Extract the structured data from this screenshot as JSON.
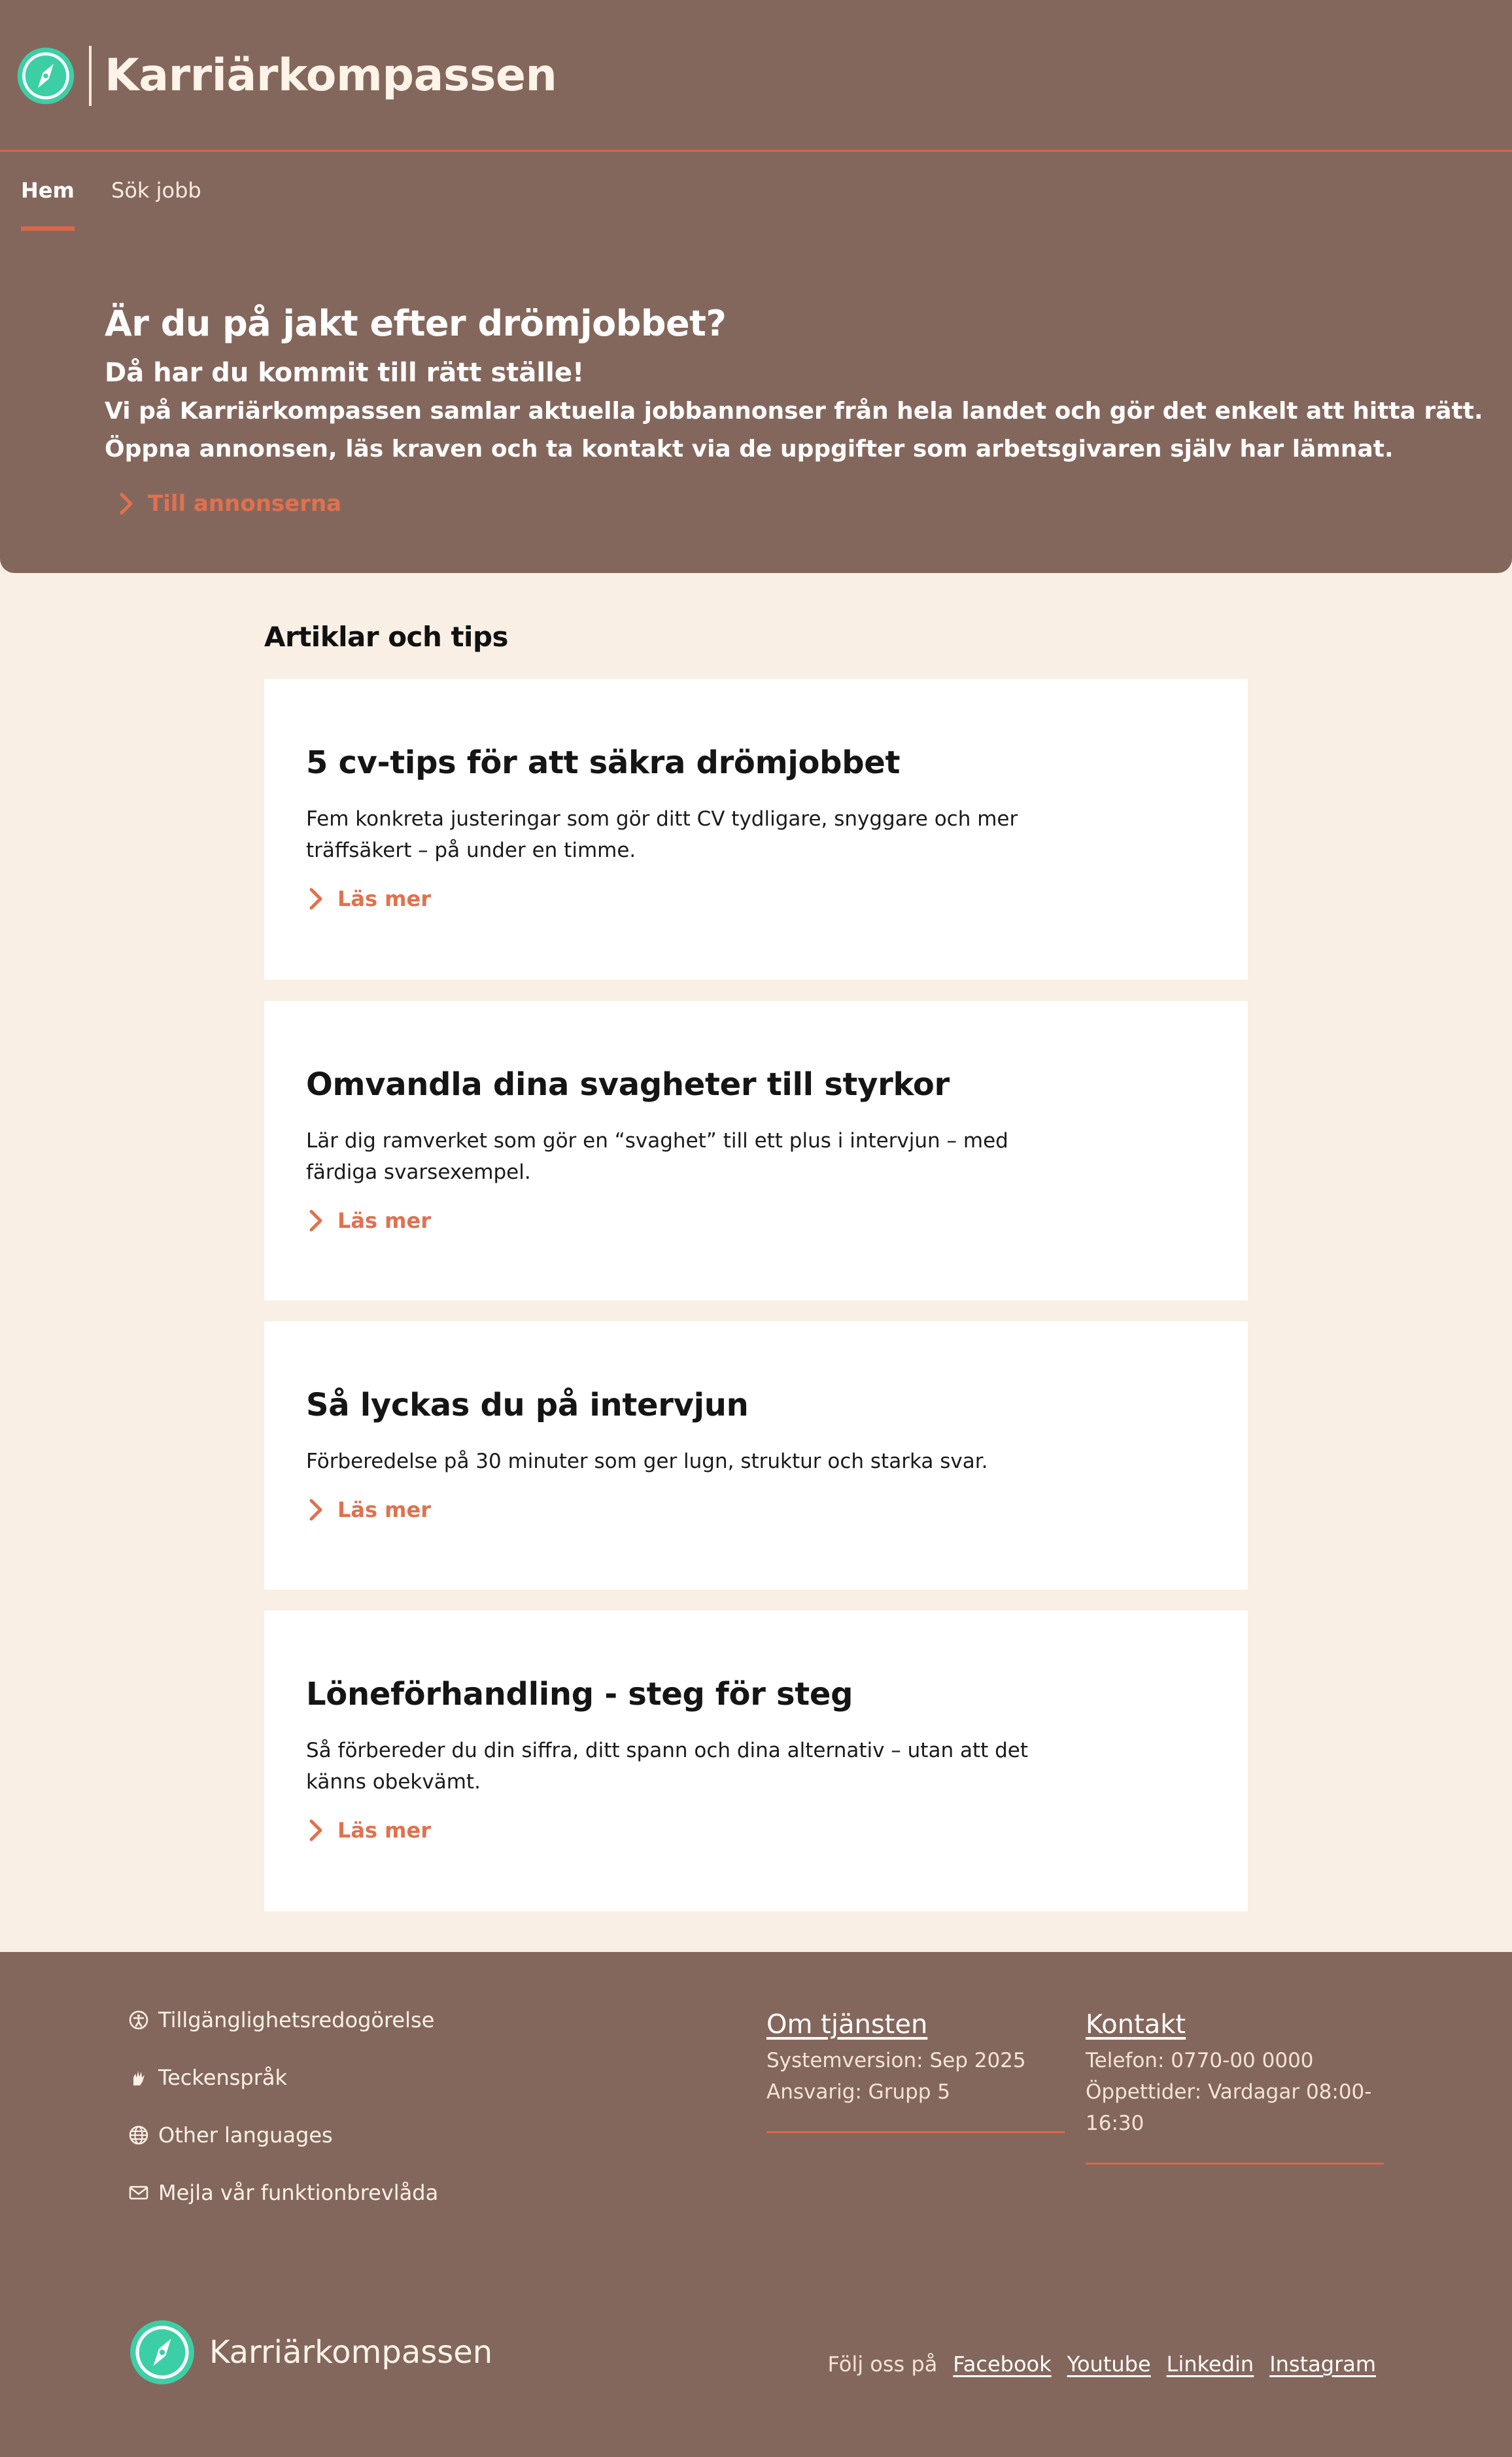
{
  "header": {
    "brand_name": "Karriärkompassen",
    "logo_icon": "compass-icon",
    "nav": [
      {
        "label": "Hem",
        "active": true
      },
      {
        "label": "Sök jobb",
        "active": false
      }
    ]
  },
  "hero": {
    "title": "Är du på jakt efter drömjobbet?",
    "subtitle": "Då har du kommit till rätt ställe!",
    "text_line1": "Vi på Karriärkompassen samlar aktuella jobbannonser från hela landet och gör det enkelt att hitta rätt.",
    "text_line2": "Öppna annonsen, läs kraven och ta kontakt via de uppgifter som arbetsgivaren själv har lämnat.",
    "link_label": "Till annonserna"
  },
  "articles": {
    "heading": "Artiklar och tips",
    "link_label": "Läs mer",
    "items": [
      {
        "title": "5 cv-tips för att säkra drömjobbet",
        "description": "Fem konkreta justeringar som gör ditt CV tydligare, snyggare och mer träffsäkert – på under en timme."
      },
      {
        "title": "Omvandla dina svagheter till styrkor",
        "description": "Lär dig ramverket som gör en “svaghet” till ett plus i intervjun – med färdiga svarsexempel."
      },
      {
        "title": "Så lyckas du på intervjun",
        "description": "Förberedelse på 30 minuter som ger lugn, struktur och starka svar."
      },
      {
        "title": "Löneförhandling - steg för steg",
        "description": "Så förbereder du din siffra, ditt spann och dina alternativ – utan att det känns obekvämt."
      }
    ]
  },
  "footer": {
    "links": [
      {
        "label": "Tillgänglighetsredogörelse",
        "icon": "accessibility-icon"
      },
      {
        "label": "Teckenspråk",
        "icon": "sign-language-icon"
      },
      {
        "label": "Other languages",
        "icon": "globe-icon"
      },
      {
        "label": "Mejla vår funktionbrevlåda",
        "icon": "mail-icon"
      }
    ],
    "about": {
      "title": "Om tjänsten",
      "line1": "Systemversion: Sep 2025",
      "line2": "Ansvarig: Grupp 5"
    },
    "contact": {
      "title": "Kontakt",
      "line1": "Telefon: 0770-00 0000",
      "line2": "Öppettider: Vardagar 08:00-",
      "line3": "16:30"
    },
    "brand_name": "Karriärkompassen",
    "social_label": "Följ oss på",
    "social": [
      "Facebook",
      "Youtube",
      "Linkedin",
      "Instagram"
    ]
  },
  "colors": {
    "brown": "#84675c",
    "cream": "#f9efe5",
    "accent": "#d9674a",
    "logo_teal": "#3ccfa6"
  }
}
